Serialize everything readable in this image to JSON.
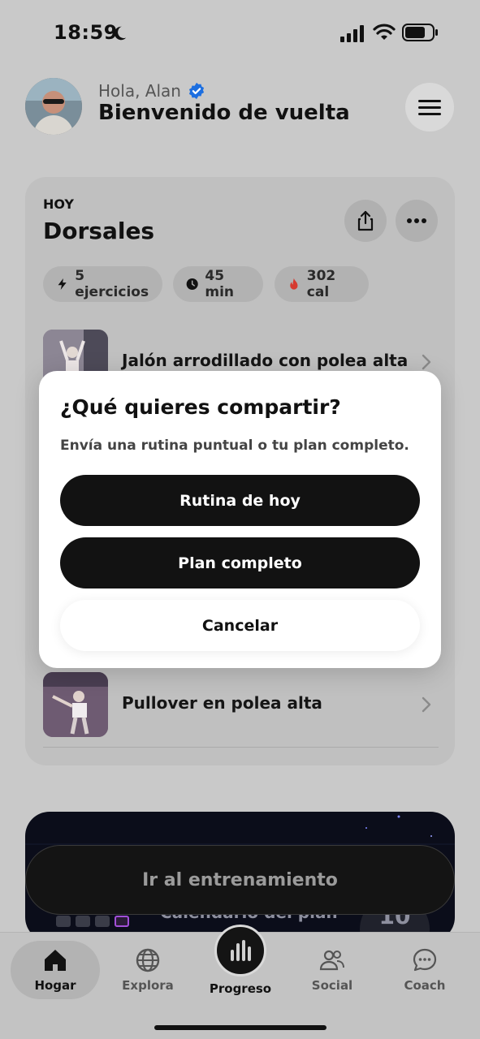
{
  "status_bar": {
    "time": "18:59"
  },
  "header": {
    "greeting": "Hola, Alan",
    "welcome": "Bienvenido de vuelta"
  },
  "routine_card": {
    "today_label": "HOY",
    "title": "Dorsales",
    "chips": {
      "exercises": "5 ejercicios",
      "duration": "45 min",
      "calories": "302 cal"
    },
    "exercises": [
      {
        "name": "Jalón arrodillado con polea alta"
      },
      {
        "name": "Pullover en polea alta"
      }
    ]
  },
  "promo": {
    "title": "Calendario del plan",
    "number": "10"
  },
  "go_button": {
    "label": "Ir al entrenamiento"
  },
  "share_modal": {
    "title": "¿Qué quieres compartir?",
    "subtitle": "Envía una rutina puntual o tu plan completo.",
    "today_routine_label": "Rutina de hoy",
    "full_plan_label": "Plan completo",
    "cancel_label": "Cancelar"
  },
  "bottom_nav": {
    "items": [
      {
        "label": "Hogar",
        "icon": "home-icon",
        "active": true
      },
      {
        "label": "Explora",
        "icon": "globe-icon"
      },
      {
        "label": "Progreso",
        "icon": "bar-chart-icon"
      },
      {
        "label": "Social",
        "icon": "users-icon"
      },
      {
        "label": "Coach",
        "icon": "chat-icon"
      }
    ]
  },
  "colors": {
    "overlay_background": "#c9c9c9",
    "primary_button": "#121212",
    "verified_badge": "#1d6fe0",
    "fire_icon": "#d63a2f"
  }
}
